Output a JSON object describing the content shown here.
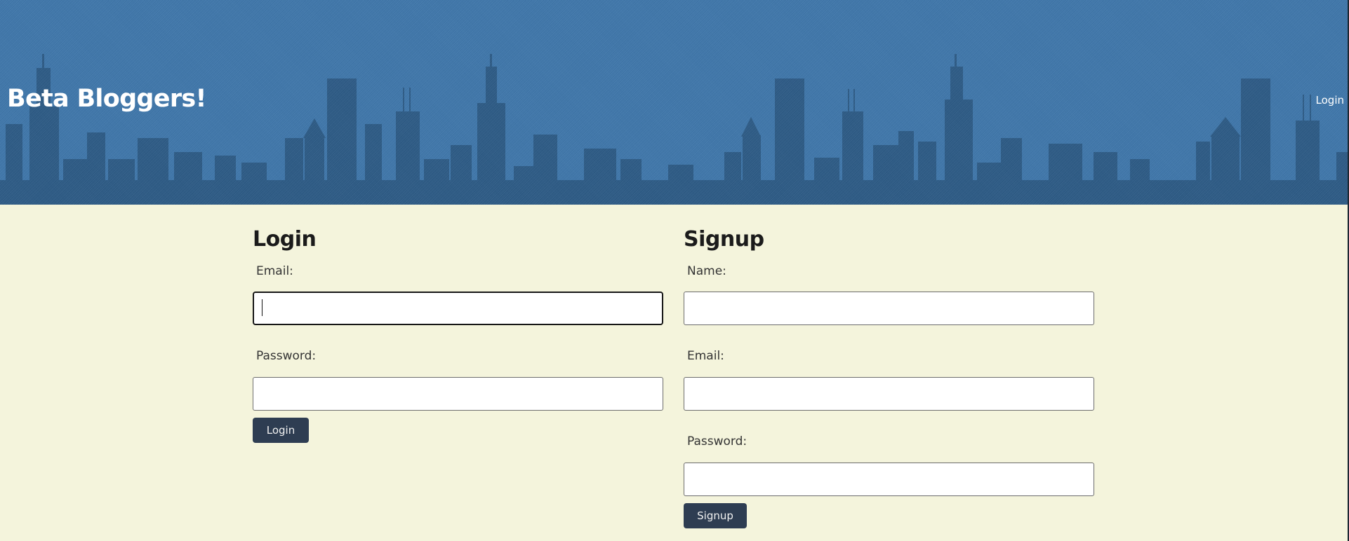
{
  "header": {
    "title": "Beta Bloggers!",
    "nav_login": "Login",
    "background_color": "#3f77ab",
    "skyline_color": "#2c5883"
  },
  "login": {
    "heading": "Login",
    "email_label": "Email:",
    "email_value": "",
    "password_label": "Password:",
    "password_value": "",
    "button_label": "Login"
  },
  "signup": {
    "heading": "Signup",
    "name_label": "Name:",
    "name_value": "",
    "email_label": "Email:",
    "email_value": "",
    "password_label": "Password:",
    "password_value": "",
    "button_label": "Signup"
  },
  "page": {
    "background_color": "#f4f4dc",
    "button_color": "#2e3d52"
  }
}
